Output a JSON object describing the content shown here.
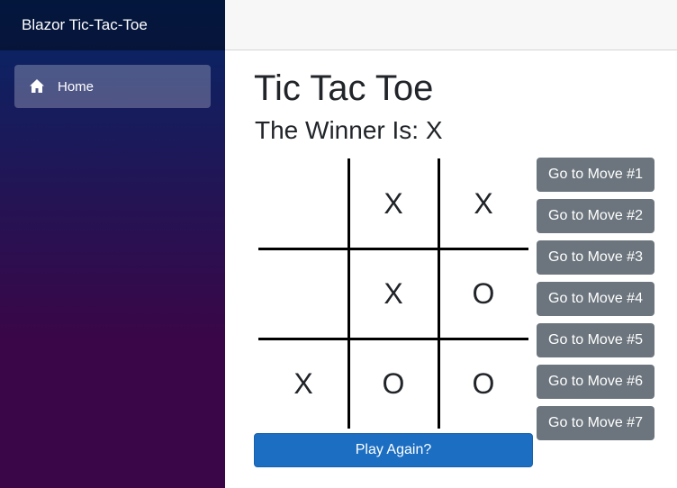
{
  "sidebar": {
    "brand": "Blazor Tic-Tac-Toe",
    "nav_items": [
      {
        "label": "Home",
        "icon": "home-icon"
      }
    ]
  },
  "main": {
    "title": "Tic Tac Toe",
    "winner_text": "The Winner Is: X",
    "board": [
      [
        "",
        "X",
        "X"
      ],
      [
        "",
        "X",
        "O"
      ],
      [
        "X",
        "O",
        "O"
      ]
    ],
    "move_buttons": [
      "Go to Move #1",
      "Go to Move #2",
      "Go to Move #3",
      "Go to Move #4",
      "Go to Move #5",
      "Go to Move #6",
      "Go to Move #7"
    ],
    "play_again_label": "Play Again?"
  },
  "colors": {
    "primary": "#1b6ec2",
    "secondary": "#6c757d",
    "sidebar_top": "#052767",
    "sidebar_bottom": "#3a0647"
  }
}
